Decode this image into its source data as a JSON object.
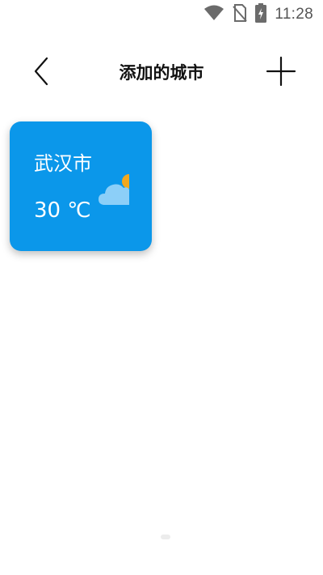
{
  "status_bar": {
    "time": "11:28",
    "icons": [
      "wifi-icon",
      "no-sim-icon",
      "battery-charging-icon"
    ]
  },
  "header": {
    "title": "添加的城市",
    "back_icon": "chevron-left-icon",
    "add_icon": "plus-icon"
  },
  "cities": [
    {
      "name": "武汉市",
      "temperature": "30 ℃",
      "weather_icon": "partly-cloudy-icon",
      "card_color": "#0b97ea"
    }
  ],
  "colors": {
    "card": "#0b97ea",
    "cloud": "#8ccff8",
    "sun": "#f2a81d"
  }
}
